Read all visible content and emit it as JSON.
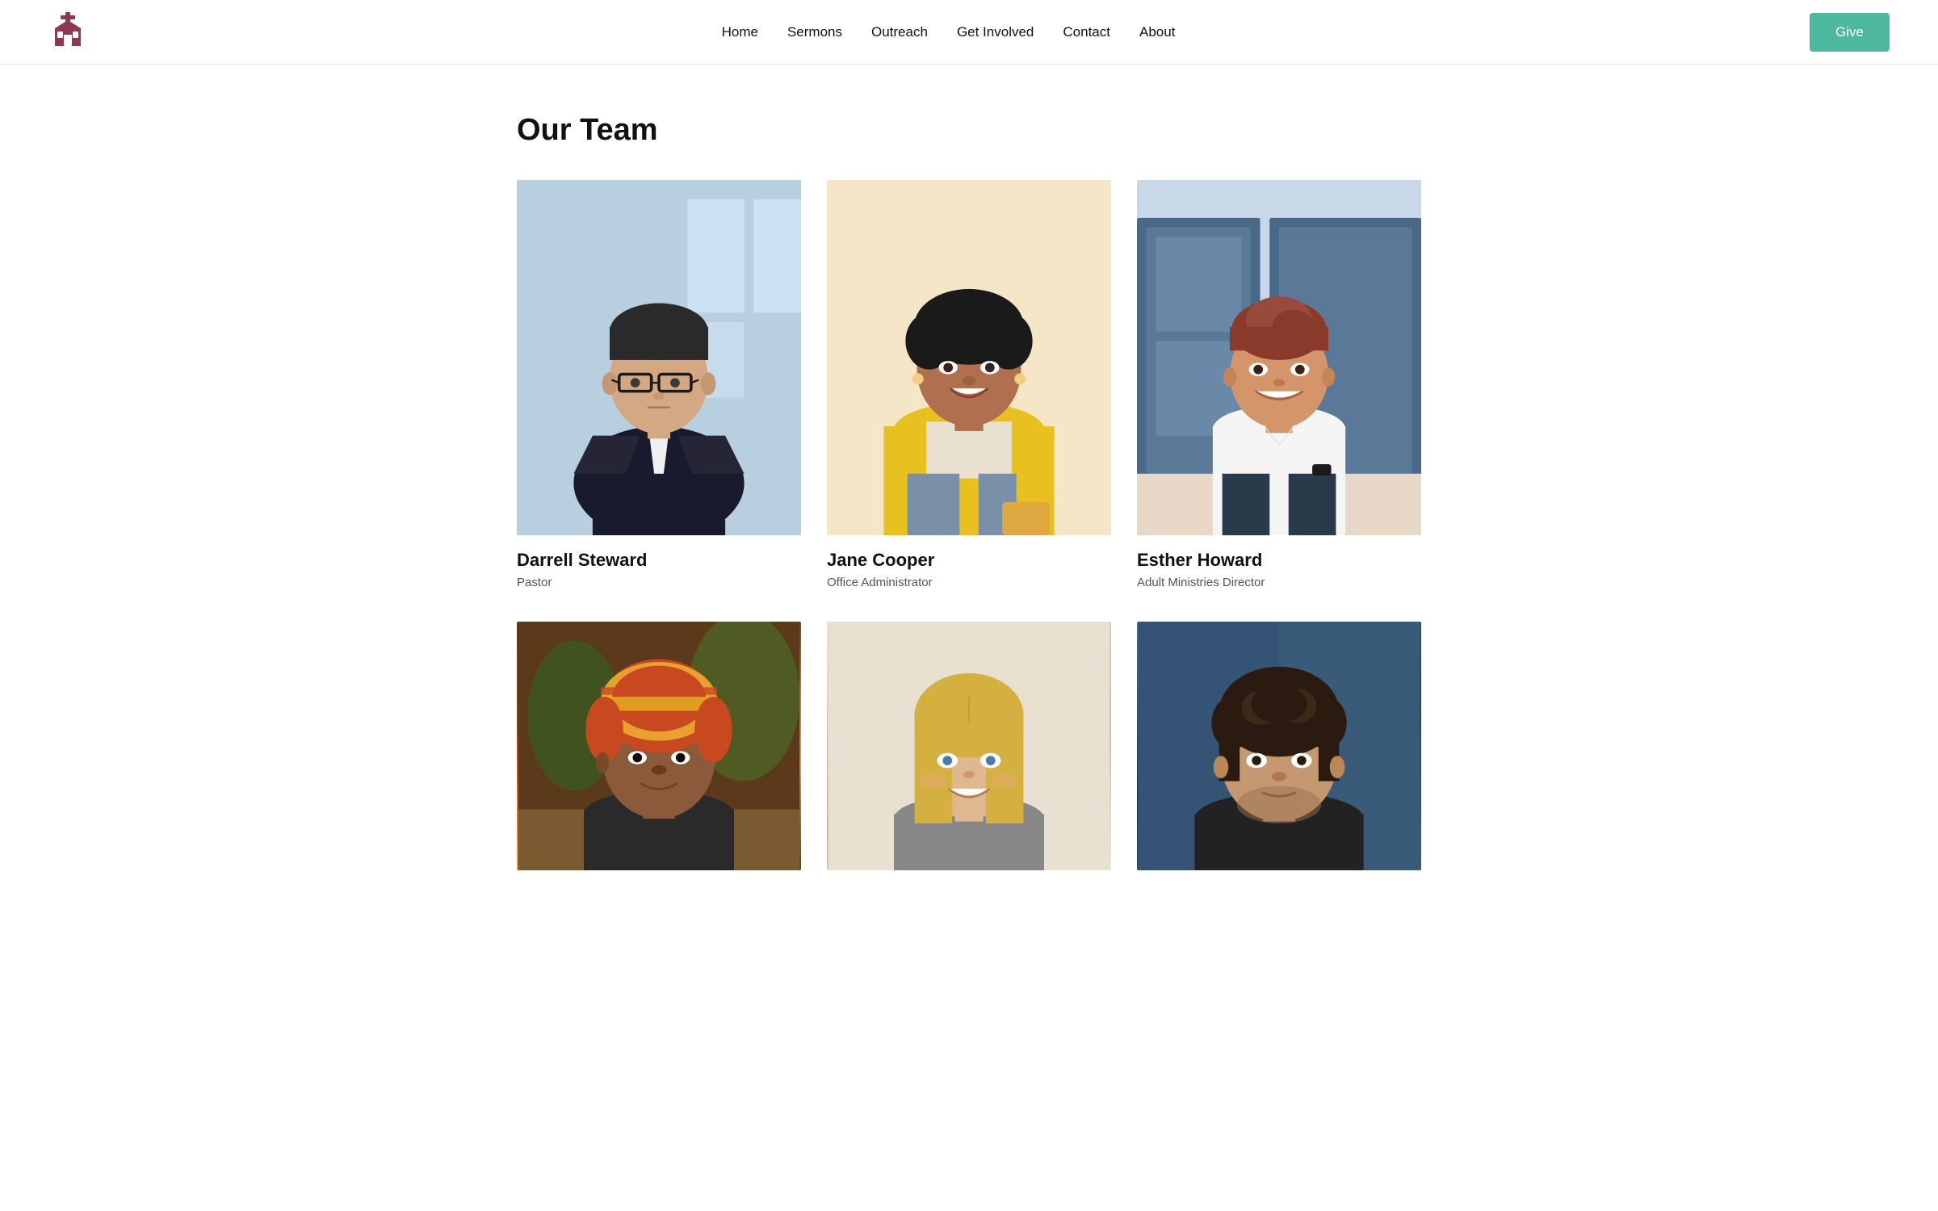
{
  "header": {
    "logo_alt": "Church Logo",
    "nav_items": [
      {
        "label": "Home",
        "href": "#"
      },
      {
        "label": "Sermons",
        "href": "#"
      },
      {
        "label": "Outreach",
        "href": "#"
      },
      {
        "label": "Get Involved",
        "href": "#"
      },
      {
        "label": "Contact",
        "href": "#"
      },
      {
        "label": "About",
        "href": "#"
      }
    ],
    "give_button": "Give"
  },
  "main": {
    "section_title": "Our Team",
    "team_members": [
      {
        "name": "Darrell Steward",
        "role": "Pastor",
        "img_class": "person1-bg"
      },
      {
        "name": "Jane Cooper",
        "role": "Office Administrator",
        "img_class": "person2-bg"
      },
      {
        "name": "Esther Howard",
        "role": "Adult Ministries Director",
        "img_class": "person3-bg"
      },
      {
        "name": "",
        "role": "",
        "img_class": "person4-bg"
      },
      {
        "name": "",
        "role": "",
        "img_class": "person5-bg"
      },
      {
        "name": "",
        "role": "",
        "img_class": "person6-bg"
      }
    ]
  }
}
